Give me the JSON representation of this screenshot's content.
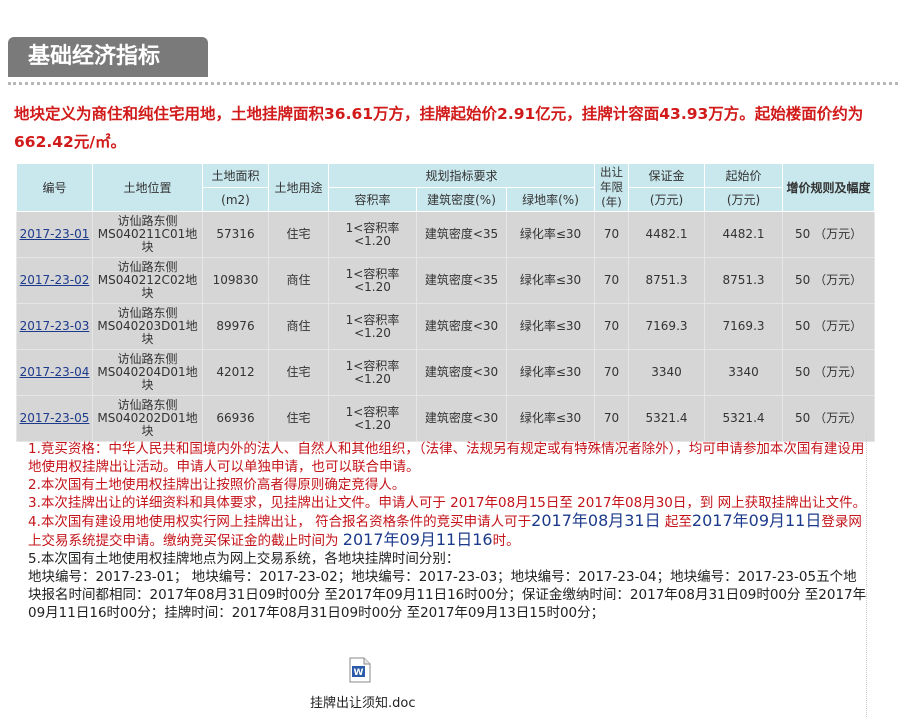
{
  "section_title": "基础经济指标",
  "intro": "地块定义为商住和纯住宅用地，土地挂牌面积36.61万方，挂牌起始价2.91亿元，挂牌计容面43.93万方。起始楼面价约为662.42元/㎡。",
  "table": {
    "headers": {
      "code": "编号",
      "location": "土地位置",
      "area": "土地面积",
      "area_unit": "(m2)",
      "use": "土地用途",
      "planning": "规划指标要求",
      "far": "容积率",
      "density": "建筑密度(%)",
      "green": "绿地率(%)",
      "term": "出让年限(年)",
      "deposit": "保证金",
      "deposit_unit": "(万元)",
      "start_price": "起始价",
      "start_price_unit": "(万元)",
      "increment": "增价规则及幅度"
    },
    "rows": [
      {
        "code": "2017-23-01",
        "location": "访仙路东侧MS040211C01地块",
        "area": "57316",
        "use": "住宅",
        "far": "1<容积率<1.20",
        "density": "建筑密度<35",
        "green": "绿化率≤30",
        "term": "70",
        "deposit": "4482.1",
        "start_price": "4482.1",
        "increment": "50 （万元）"
      },
      {
        "code": "2017-23-02",
        "location": "访仙路东侧MS040212C02地块",
        "area": "109830",
        "use": "商住",
        "far": "1<容积率<1.20",
        "density": "建筑密度<35",
        "green": "绿化率≤30",
        "term": "70",
        "deposit": "8751.3",
        "start_price": "8751.3",
        "increment": "50 （万元）"
      },
      {
        "code": "2017-23-03",
        "location": "访仙路东侧MS040203D01地块",
        "area": "89976",
        "use": "商住",
        "far": "1<容积率<1.20",
        "density": "建筑密度<30",
        "green": "绿化率≤30",
        "term": "70",
        "deposit": "7169.3",
        "start_price": "7169.3",
        "increment": "50 （万元）"
      },
      {
        "code": "2017-23-04",
        "location": "访仙路东侧MS040204D01地块",
        "area": "42012",
        "use": "住宅",
        "far": "1<容积率<1.20",
        "density": "建筑密度<30",
        "green": "绿化率≤30",
        "term": "70",
        "deposit": "3340",
        "start_price": "3340",
        "increment": "50 （万元）"
      },
      {
        "code": "2017-23-05",
        "location": "访仙路东侧MS040202D01地块",
        "area": "66936",
        "use": "住宅",
        "far": "1<容积率<1.20",
        "density": "建筑密度<30",
        "green": "绿化率≤30",
        "term": "70",
        "deposit": "5321.4",
        "start_price": "5321.4",
        "increment": "50 （万元）"
      }
    ]
  },
  "notes": {
    "n1": "1.竞买资格：中华人民共和国境内外的法人、自然人和其他组织，（法律、法规另有规定或有特殊情况者除外），均可申请参加本次国有建设用地使用权挂牌出让活动。申请人可以单独申请，也可以联合申请。",
    "n2": "2.本次国有土地使用权挂牌出让按照价高者得原则确定竞得人。",
    "n3": "3.本次挂牌出让的详细资料和具体要求，见挂牌出让文件。申请人可于 2017年08月15日至 2017年08月30日，到 网上获取挂牌出让文件。",
    "n4_a": "4.本次国有建设用地使用权实行网上挂牌出让， 符合报名资格条件的竞买申请人可于",
    "n4_b": "2017年08月31日",
    "n4_c": " 起至",
    "n4_d": "2017年09月11日",
    "n4_e": "登录网上交易系统提交申请。缴纳竞买保证金的截止时间为 ",
    "n4_f": "2017年09月11日16",
    "n4_g": "时。",
    "n5": "5.本次国有土地使用权挂牌地点为网上交易系统，各地块挂牌时间分别：",
    "n6": "地块编号：2017-23-01； 地块编号：2017-23-02；地块编号：2017-23-03；地块编号：2017-23-04；地块编号：2017-23-05五个地块报名时间都相同：2017年08月31日09时00分 至2017年09月11日16时00分；保证金缴纳时间：2017年08月31日09时00分 至2017年09月11日16时00分；挂牌时间：2017年08月31日09时00分 至2017年09月13日15时00分；"
  },
  "attachment": {
    "name": "挂牌出让须知.doc",
    "icon": "word-doc-icon"
  }
}
